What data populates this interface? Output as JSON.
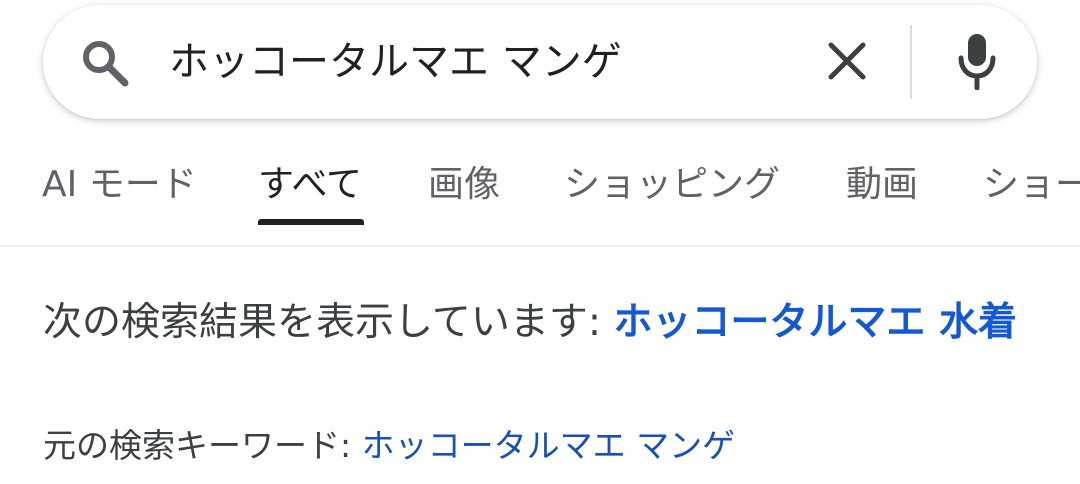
{
  "search": {
    "query": "ホッコータルマエ マンゲ",
    "clear_icon": "close-icon",
    "mic_icon": "microphone-icon",
    "search_icon": "search-icon"
  },
  "tabs": [
    {
      "label": "AI モード",
      "active": false
    },
    {
      "label": "すべて",
      "active": true
    },
    {
      "label": "画像",
      "active": false
    },
    {
      "label": "ショッピング",
      "active": false
    },
    {
      "label": "動画",
      "active": false
    },
    {
      "label": "ショー",
      "active": false
    }
  ],
  "correction": {
    "showing_prefix": "次の検索結果を表示しています: ",
    "showing_query": "ホッコータルマエ 水着",
    "original_prefix": "元の検索キーワード: ",
    "original_query": "ホッコータルマエ マンゲ"
  },
  "colors": {
    "link_bold": "#1558d6",
    "link": "#1a4fb8",
    "text": "#3c4043"
  }
}
